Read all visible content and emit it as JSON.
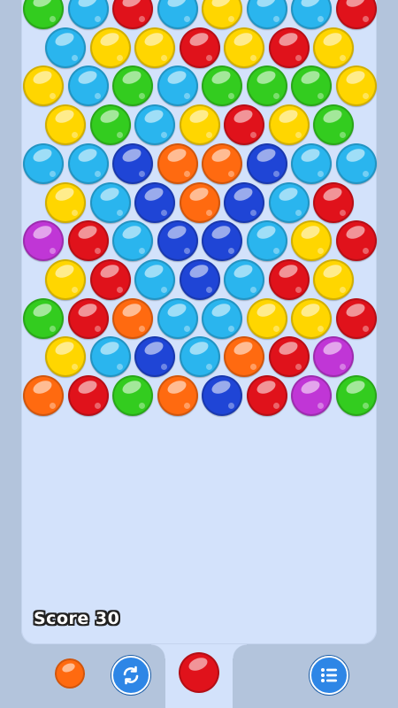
{
  "score": {
    "label": "Score",
    "value": "30"
  },
  "colors": {
    "yellow": "#ffd600",
    "cyan": "#2ab5ee",
    "red": "#e0121b",
    "green": "#33cc1f",
    "blue": "#1f45d6",
    "orange": "#ff6a10",
    "purple": "#c036d6"
  },
  "bubble_rows": [
    [
      "green",
      "cyan",
      "red",
      "cyan",
      "yellow",
      "cyan",
      "cyan",
      "red"
    ],
    [
      "cyan",
      "yellow",
      "yellow",
      "red",
      "yellow",
      "red",
      "yellow"
    ],
    [
      "yellow",
      "cyan",
      "green",
      "cyan",
      "green",
      "green",
      "green",
      "yellow"
    ],
    [
      "yellow",
      "green",
      "cyan",
      "yellow",
      "red",
      "yellow",
      "green"
    ],
    [
      "cyan",
      "cyan",
      "blue",
      "orange",
      "orange",
      "blue",
      "cyan",
      "cyan"
    ],
    [
      "yellow",
      "cyan",
      "blue",
      "orange",
      "blue",
      "cyan",
      "red"
    ],
    [
      "purple",
      "red",
      "cyan",
      "blue",
      "blue",
      "cyan",
      "yellow",
      "red"
    ],
    [
      "yellow",
      "red",
      "cyan",
      "blue",
      "cyan",
      "red",
      "yellow"
    ],
    [
      "green",
      "red",
      "orange",
      "cyan",
      "cyan",
      "yellow",
      "yellow",
      "red"
    ],
    [
      "yellow",
      "cyan",
      "blue",
      "cyan",
      "orange",
      "red",
      "purple"
    ],
    [
      "orange",
      "red",
      "green",
      "orange",
      "blue",
      "red",
      "purple",
      "green"
    ]
  ],
  "next_bubble": "orange",
  "current_bubble": "red",
  "buttons": {
    "swap_icon": "swap-arrows-icon",
    "menu_icon": "menu-list-icon"
  }
}
